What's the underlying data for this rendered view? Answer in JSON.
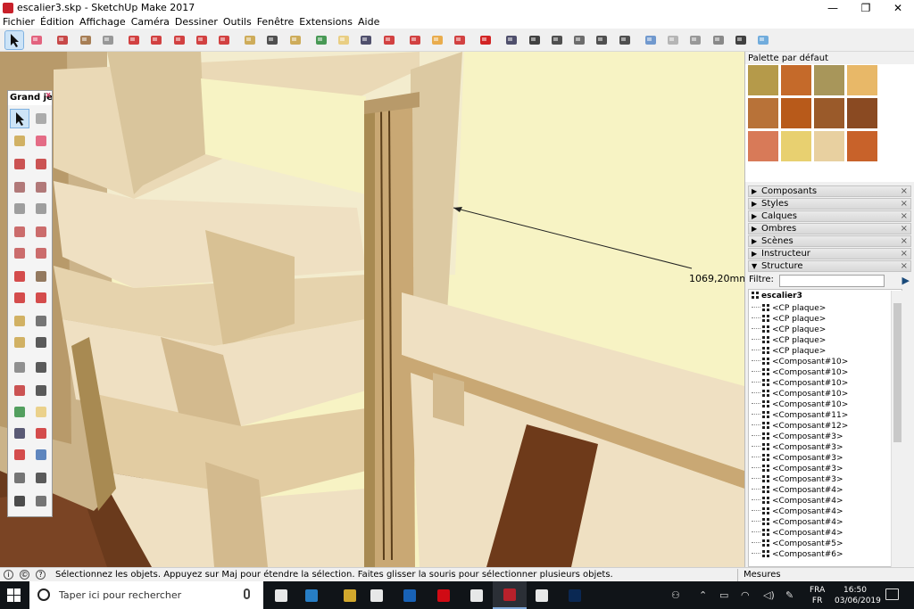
{
  "window": {
    "title": "escalier3.skp - SketchUp Make 2017",
    "controls": {
      "minimize": "—",
      "restore": "❐",
      "close": "✕"
    }
  },
  "menubar": {
    "items": [
      "Fichier",
      "Édition",
      "Affichage",
      "Caméra",
      "Dessiner",
      "Outils",
      "Fenêtre",
      "Extensions",
      "Aide"
    ]
  },
  "toolbar": {
    "tools": [
      "select-tool-icon",
      "eraser-icon",
      "pencil-icon",
      "arc-icon",
      "circle-icon",
      "push-pull-icon",
      "follow-me-icon",
      "move-icon",
      "rotate-icon",
      "scale-icon",
      "tape-measure-icon",
      "text-icon",
      "paint-bucket-icon",
      "orbit-icon",
      "pan-icon",
      "zoom-icon",
      "zoom-extents-icon",
      "warehouse-icon",
      "extension-warehouse-icon",
      "layout-icon",
      "ruby-icon",
      "iso-view-icon",
      "top-view-icon",
      "front-view-icon",
      "right-view-icon",
      "back-view-icon",
      "left-view-icon",
      "xray-icon",
      "wireframe-icon",
      "hidden-line-icon",
      "shaded-icon",
      "shaded-textures-icon",
      "monochrome-icon"
    ],
    "selected_index": 0
  },
  "tool_palette": {
    "title": "Grand je...",
    "close": "x",
    "selected_index": 0
  },
  "viewport": {
    "dimension_label": "1069,20mm",
    "colors": {
      "sky": "#f7f3c4",
      "plywood": "#efe0c2",
      "plywood_dark": "#ddc7a0",
      "edge": "#c9a874",
      "floor": "#6a3a1c"
    }
  },
  "materials": {
    "title": "Palette par défaut",
    "swatches": [
      "#b59a4a",
      "#c56a2a",
      "#a8965a",
      "#e8b868",
      "#b87238",
      "#b85a1a",
      "#9a5a2a",
      "#8a4a22",
      "#d87a58",
      "#e8d070",
      "#e8d0a0",
      "#c8622a"
    ]
  },
  "tray_sections": [
    {
      "label": "Composants",
      "expanded": false
    },
    {
      "label": "Styles",
      "expanded": false
    },
    {
      "label": "Calques",
      "expanded": false
    },
    {
      "label": "Ombres",
      "expanded": false
    },
    {
      "label": "Scènes",
      "expanded": false
    },
    {
      "label": "Instructeur",
      "expanded": false
    },
    {
      "label": "Structure",
      "expanded": true
    }
  ],
  "outliner": {
    "filter_label": "Filtre:",
    "filter_value": "",
    "root": "escalier3",
    "items": [
      "<CP plaque>",
      "<CP plaque>",
      "<CP plaque>",
      "<CP plaque>",
      "<CP plaque>",
      "<Composant#10>",
      "<Composant#10>",
      "<Composant#10>",
      "<Composant#10>",
      "<Composant#10>",
      "<Composant#11>",
      "<Composant#12>",
      "<Composant#3>",
      "<Composant#3>",
      "<Composant#3>",
      "<Composant#3>",
      "<Composant#3>",
      "<Composant#4>",
      "<Composant#4>",
      "<Composant#4>",
      "<Composant#4>",
      "<Composant#4>",
      "<Composant#5>",
      "<Composant#6>"
    ]
  },
  "statusbar": {
    "text": "Sélectionnez les objets. Appuyez sur Maj pour étendre la sélection. Faites glisser la souris pour sélectionner plusieurs objets.",
    "measure_label": "Mesures",
    "icons": [
      "info-icon",
      "credits-icon",
      "help-icon"
    ]
  },
  "taskbar": {
    "search_placeholder": "Taper ici pour rechercher",
    "apps": [
      "task-view-icon",
      "edge-icon",
      "file-explorer-icon",
      "store-icon",
      "outlook-icon",
      "netflix-icon",
      "calculator-icon",
      "sketchup-icon",
      "photos-icon",
      "photoshop-icon"
    ],
    "active_app_index": 7,
    "lang_top": "FRA",
    "lang_bottom": "FR",
    "time": "16:50",
    "date": "03/06/2019"
  }
}
